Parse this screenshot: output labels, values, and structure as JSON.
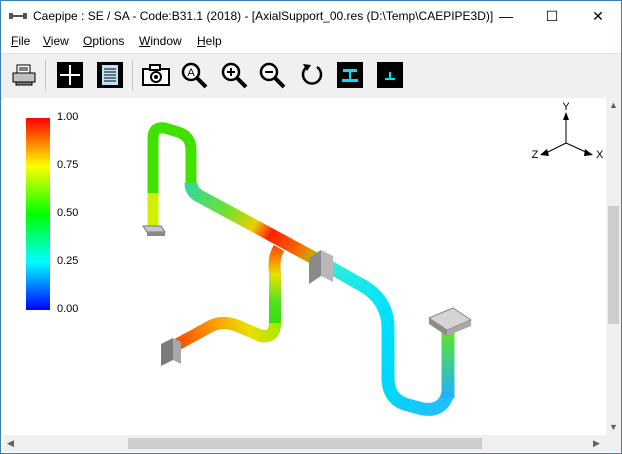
{
  "window": {
    "title": "Caepipe : SE / SA - Code:B31.1 (2018) -  [AxialSupport_00.res (D:\\Temp\\CAEPIPE3D)]",
    "minimize_glyph": "—",
    "maximize_glyph": "☐",
    "close_glyph": "✕"
  },
  "menu": [
    {
      "key": "F",
      "rest": "ile"
    },
    {
      "key": "V",
      "rest": "iew"
    },
    {
      "key": "O",
      "rest": "ptions"
    },
    {
      "key": "W",
      "rest": "indow"
    },
    {
      "key": "H",
      "rest": "elp"
    }
  ],
  "toolbar": {
    "icons": [
      "print-icon",
      "crosshair-icon",
      "document-icon",
      "camera-icon",
      "zoom-auto-icon",
      "zoom-in-icon",
      "zoom-out-icon",
      "rotate-icon",
      "anchor-support-icon",
      "small-support-icon"
    ],
    "zoom_auto_letter": "A"
  },
  "legend": {
    "ticks": [
      "1.00",
      "0.75",
      "0.50",
      "0.25",
      "0.00"
    ],
    "colors": [
      "#ff0000",
      "#ffff00",
      "#00ff00",
      "#00ffff",
      "#0000ff"
    ]
  },
  "axes": {
    "y": "Y",
    "z": "Z",
    "x": "X"
  }
}
